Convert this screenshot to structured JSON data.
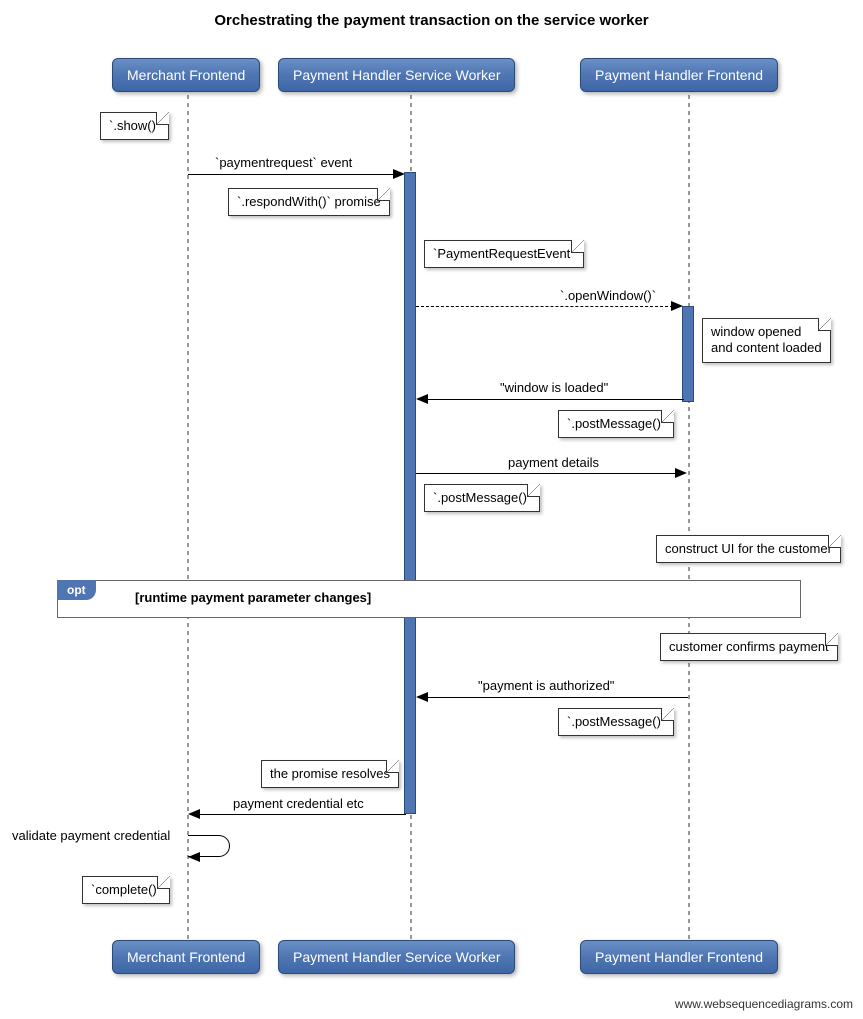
{
  "title": "Orchestrating the payment transaction on the service worker",
  "actors": {
    "merchant": "Merchant Frontend",
    "sw": "Payment Handler Service Worker",
    "frontend": "Payment Handler Frontend"
  },
  "notes": {
    "show": "`.show()`",
    "respondWith": "`.respondWith()` promise",
    "pre": "`PaymentRequestEvent`",
    "windowOpened": "window opened\nand content loaded",
    "postMsg1": "`.postMessage()`",
    "postMsg2": "`.postMessage()`",
    "constructUI": "construct UI for the customer",
    "confirm": "customer confirms payment",
    "postMsg3": "`.postMessage()`",
    "promiseResolves": "the promise resolves",
    "complete": "`complete()`"
  },
  "messages": {
    "paymentRequest": "`paymentrequest` event",
    "openWindow": "`.openWindow()`",
    "windowLoaded": "\"window is loaded\"",
    "paymentDetails": "payment details",
    "paymentAuthorized": "\"payment is authorized\"",
    "paymentCredential": "payment credential etc",
    "selfValidate": "validate payment credential"
  },
  "opt": {
    "label": "opt",
    "guard": "[runtime payment parameter changes]"
  },
  "footer": "www.websequencediagrams.com"
}
